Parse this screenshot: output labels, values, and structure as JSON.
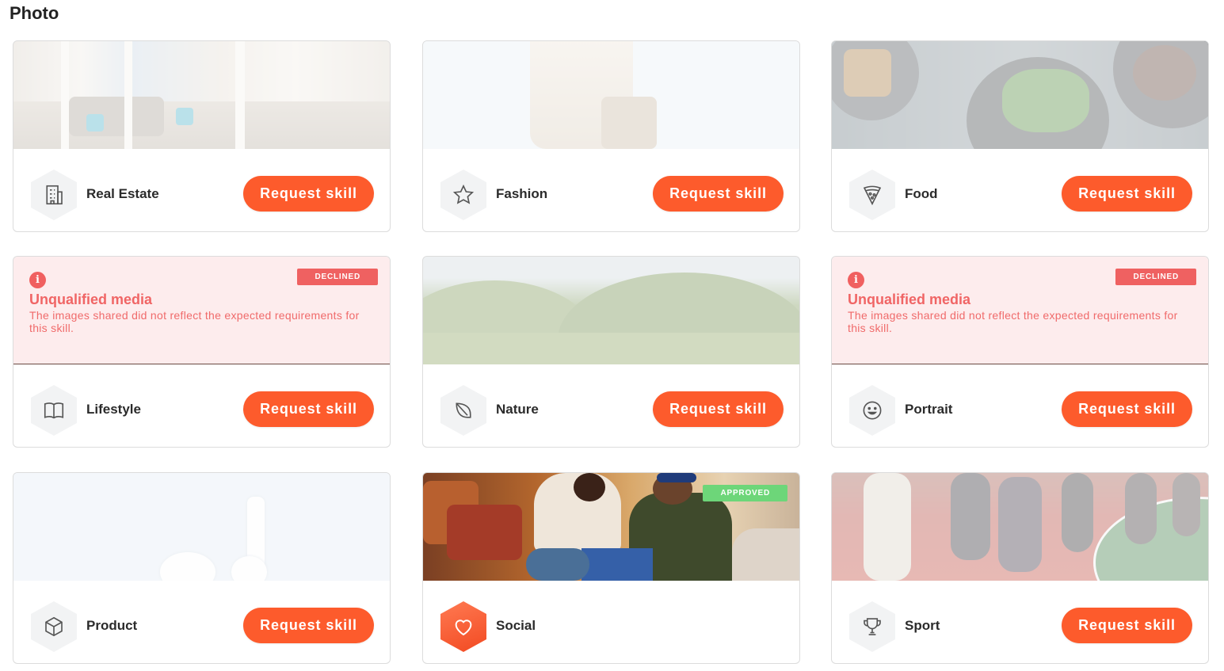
{
  "section": {
    "title": "Photo"
  },
  "request_label": "Request skill",
  "cards": [
    {
      "name": "Real Estate",
      "icon": "building-icon"
    },
    {
      "name": "Fashion",
      "icon": "star-icon"
    },
    {
      "name": "Food",
      "icon": "pizza-slice-icon"
    },
    {
      "name": "Lifestyle",
      "icon": "book-icon",
      "status": "DECLINED",
      "message_title": "Unqualified media",
      "message_text": "The images shared did not reflect the expected requirements for this skill."
    },
    {
      "name": "Nature",
      "icon": "leaf-icon"
    },
    {
      "name": "Portrait",
      "icon": "smile-icon",
      "status": "DECLINED",
      "message_title": "Unqualified media",
      "message_text": "The images shared did not reflect the expected requirements for this skill."
    },
    {
      "name": "Product",
      "icon": "box-icon"
    },
    {
      "name": "Social",
      "icon": "heart-icon",
      "status": "APPROVED"
    },
    {
      "name": "Sport",
      "icon": "trophy-icon"
    }
  ],
  "colors": {
    "accent": "#fd5b2c",
    "declined": "#ef6161",
    "approved": "#6dd679",
    "declined_background": "#fdeced"
  }
}
